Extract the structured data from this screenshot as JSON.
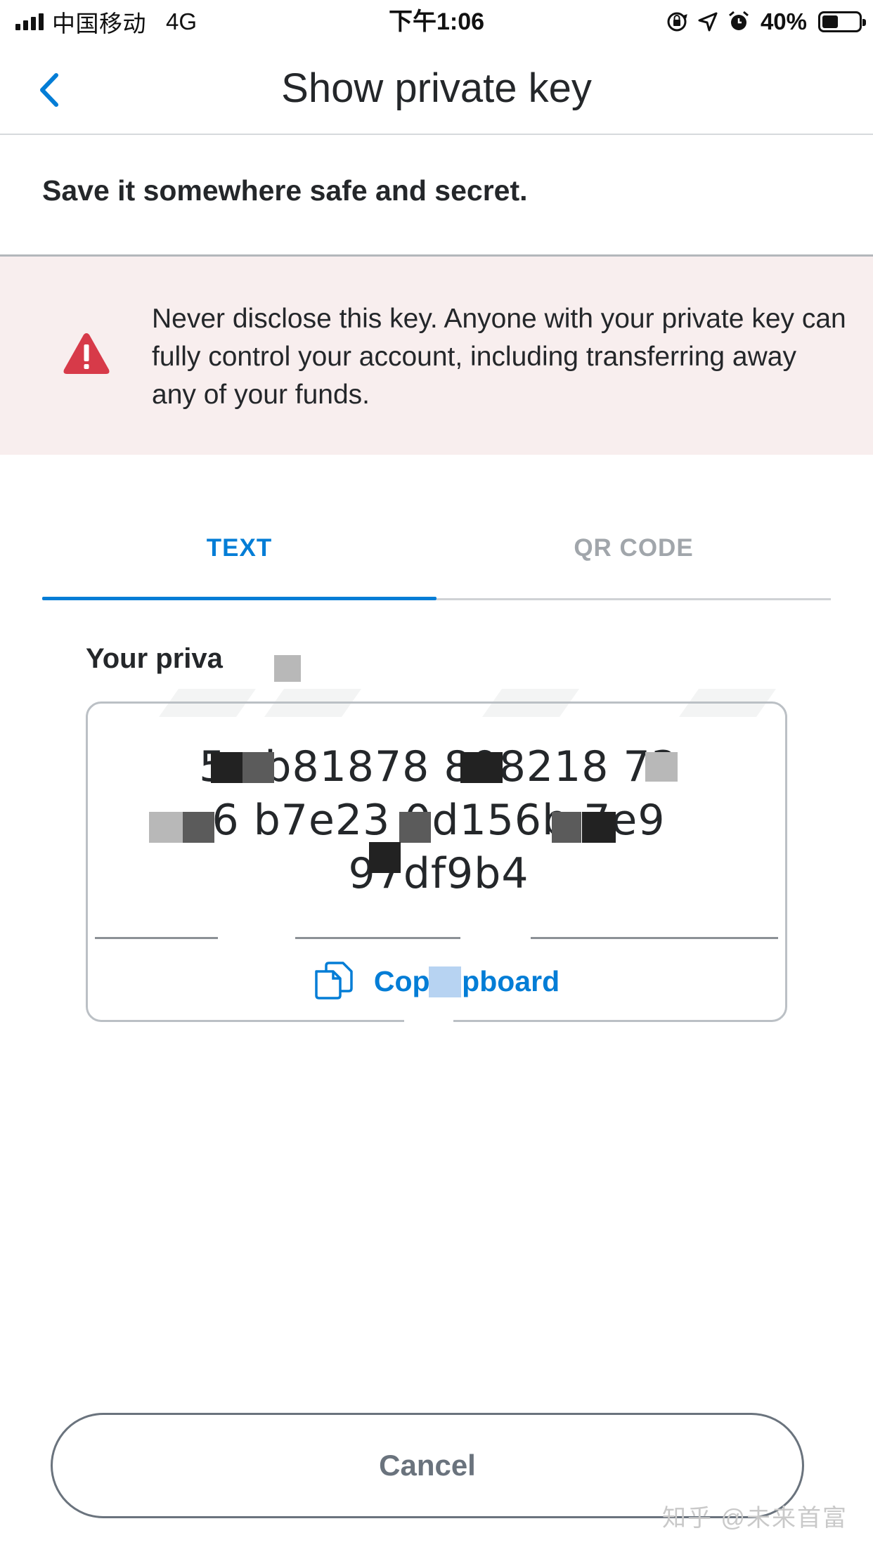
{
  "status_bar": {
    "carrier": "中国移动",
    "network": "4G",
    "time": "下午1:06",
    "battery_percent": "40%",
    "icons": [
      "signal-icon",
      "orientation-lock-icon",
      "location-icon",
      "alarm-icon",
      "battery-icon"
    ]
  },
  "header": {
    "title": "Show private key",
    "back_icon": "chevron-left-icon"
  },
  "subtitle": "Save it somewhere safe and secret.",
  "warning": {
    "icon": "warning-triangle-icon",
    "text": "Never disclose this key. Anyone with your private key can fully control your account, including transferring away any of your funds."
  },
  "tabs": [
    {
      "label": "TEXT",
      "active": true
    },
    {
      "label": "QR CODE",
      "active": false
    }
  ],
  "key_section": {
    "label": "Your priva",
    "key_lines": [
      "5c   b81878   808218   73",
      "6  b7e23   0d156b  7e9",
      "  97df9b4"
    ],
    "copy_label": "Copy    lpboard",
    "copy_icon": "copy-icon"
  },
  "cancel_label": "Cancel",
  "watermark": "知乎 @未来首富",
  "colors": {
    "accent": "#037dd6",
    "warning_bg": "#f8eeee",
    "warning_icon": "#d73a49",
    "inactive_tab": "#a1a6ab",
    "border": "#bbc0c5"
  }
}
